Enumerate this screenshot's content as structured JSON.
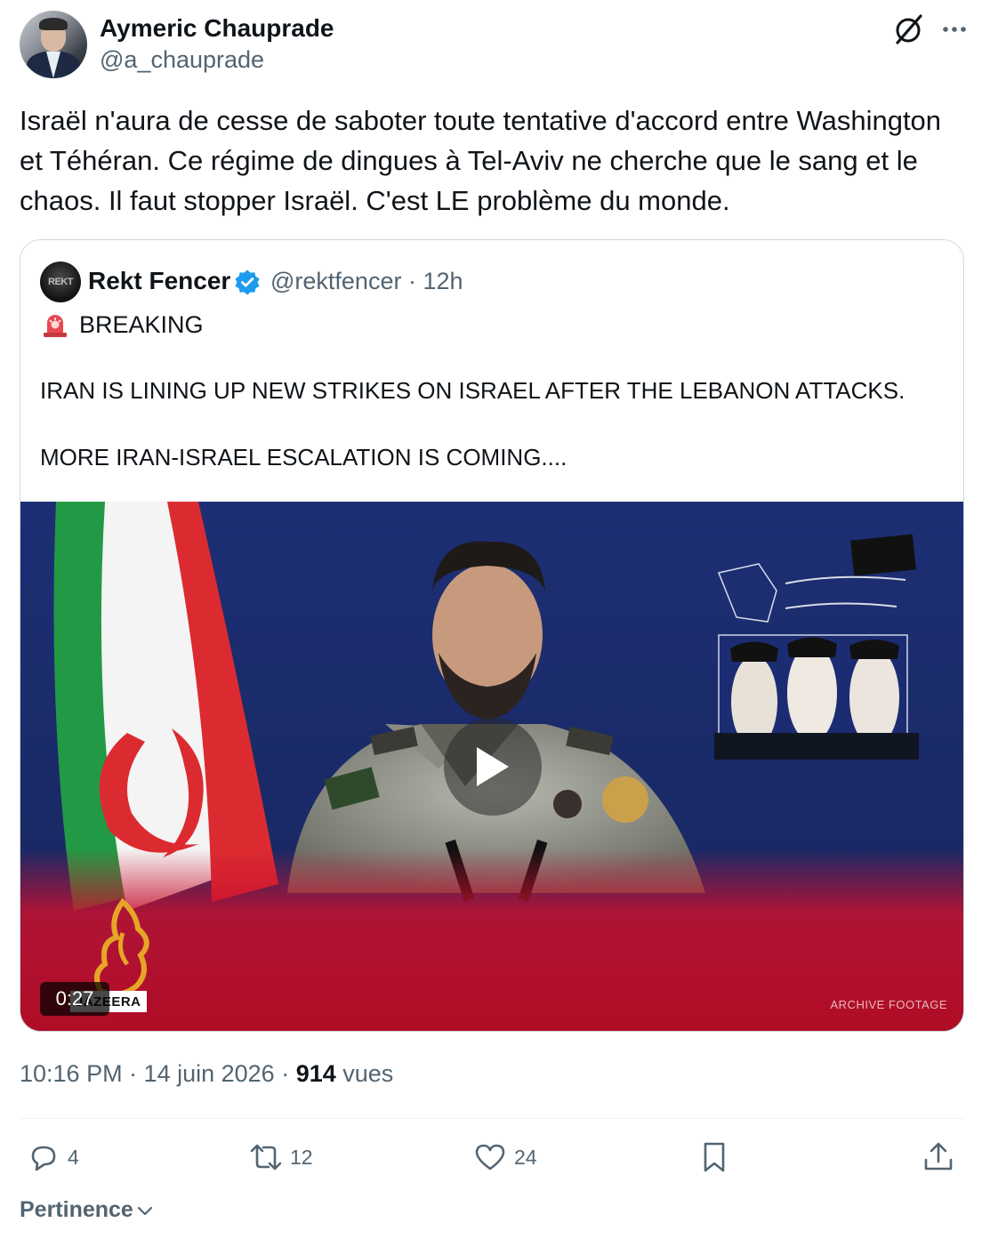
{
  "author": {
    "name": "Aymeric Chauprade",
    "handle": "@a_chauprade"
  },
  "icons": {
    "grok": "grok-icon",
    "more": "more-options-icon",
    "verified": "verified-badge-icon",
    "siren": "siren-emoji-icon",
    "play": "play-icon",
    "reply": "reply-icon",
    "retweet": "retweet-icon",
    "like": "heart-icon",
    "bookmark": "bookmark-icon",
    "share": "share-icon",
    "chevron": "chevron-down-icon"
  },
  "tweet": {
    "text": "Israël n'aura de cesse de saboter toute tentative d'accord entre Washington et Téhéran. Ce régime de dingues à Tel-Aviv ne cherche que le sang et le chaos. Il faut stopper Israël. C'est LE problème du monde."
  },
  "quote": {
    "avatar_text": "REKT",
    "name": "Rekt Fencer",
    "handle_time": "@rektfencer · 12h",
    "breaking": "BREAKING",
    "line1": "IRAN IS LINING UP NEW STRIKES ON ISRAEL AFTER THE LEBANON ATTACKS.",
    "line2": "MORE IRAN-ISRAEL ESCALATION IS COMING....",
    "video": {
      "duration": "0:27",
      "watermark": "ARCHIVE FOOTAGE",
      "channel_logo_text": "JAZEERA"
    }
  },
  "meta": {
    "time_date": "10:16 PM · 14 juin 2026 · ",
    "views_count": "914",
    "views_label": " vues"
  },
  "actions": {
    "replies": "4",
    "retweets": "12",
    "likes": "24"
  },
  "sort": {
    "label": "Pertinence"
  },
  "colors": {
    "text": "#0f1419",
    "secondary": "#536471",
    "border": "#cfd9de",
    "verified": "#1d9bf0"
  }
}
